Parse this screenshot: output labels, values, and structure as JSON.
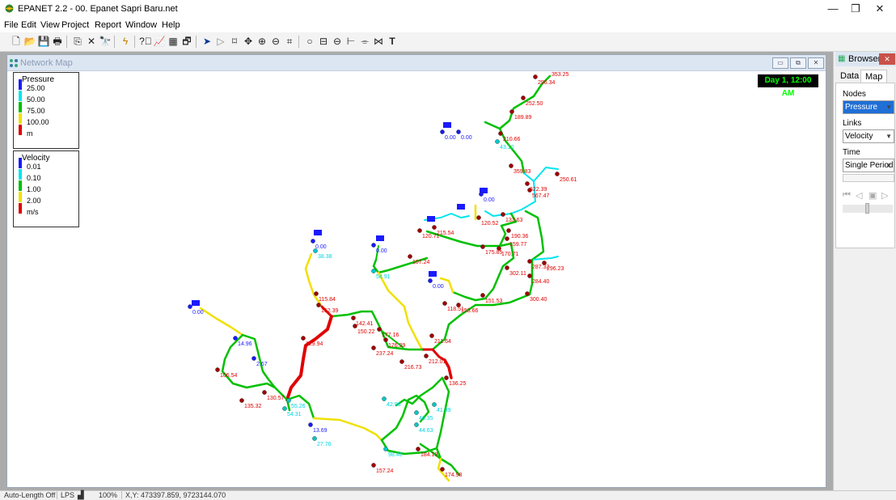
{
  "app": {
    "title": "EPANET 2.2 - 00. Epanet Sapri Baru.net"
  },
  "menu": [
    "File",
    "Edit",
    "View",
    "Project",
    "Report",
    "Window",
    "Help"
  ],
  "map_window": {
    "title": "Network Map",
    "time_display": "Day 1, 12:00 AM"
  },
  "legend_pressure": {
    "title": "Pressure",
    "entries": [
      {
        "label": "25.00",
        "color": "#1a1aff"
      },
      {
        "label": "50.00",
        "color": "#00e5ee"
      },
      {
        "label": "75.00",
        "color": "#00c000"
      },
      {
        "label": "100.00",
        "color": "#f0e000"
      }
    ],
    "top_color": "#e00000",
    "unit": "m"
  },
  "legend_velocity": {
    "title": "Velocity",
    "entries": [
      {
        "label": "0.01",
        "color": "#1a1aff"
      },
      {
        "label": "0.10",
        "color": "#00e5ee"
      },
      {
        "label": "1.00",
        "color": "#00c000"
      },
      {
        "label": "2.00",
        "color": "#f0e000"
      }
    ],
    "top_color": "#e00000",
    "unit": "m/s"
  },
  "browser": {
    "title": "Browser",
    "tabs": [
      "Data",
      "Map"
    ],
    "nodes_label": "Nodes",
    "nodes_value": "Pressure",
    "links_label": "Links",
    "links_value": "Velocity",
    "time_label": "Time",
    "time_value": "Single Period"
  },
  "status": {
    "auto_length": "Auto-Length Off",
    "flow_units": "LPS",
    "zoom": "100%",
    "xy": "X,Y: 473397.859, 9723144.070"
  },
  "node_labels": [
    {
      "t": "353.25",
      "c": "red"
    },
    {
      "t": "296.34",
      "c": "red"
    },
    {
      "t": "252.50",
      "c": "red"
    },
    {
      "t": "189.89",
      "c": "red"
    },
    {
      "t": "210.66",
      "c": "red"
    },
    {
      "t": "43.10",
      "c": "cyan"
    },
    {
      "t": "0.00",
      "c": "blue"
    },
    {
      "t": "0.00",
      "c": "blue"
    },
    {
      "t": "359.83",
      "c": "red"
    },
    {
      "t": "622.39",
      "c": "red"
    },
    {
      "t": "250.61",
      "c": "red"
    },
    {
      "t": "567.47",
      "c": "red"
    },
    {
      "t": "0.00",
      "c": "blue"
    },
    {
      "t": "120.52",
      "c": "red"
    },
    {
      "t": "133.63",
      "c": "red"
    },
    {
      "t": "215.54",
      "c": "red"
    },
    {
      "t": "120.71",
      "c": "red"
    },
    {
      "t": "190.36",
      "c": "red"
    },
    {
      "t": "159.77",
      "c": "red"
    },
    {
      "t": "175.85",
      "c": "red"
    },
    {
      "t": "170.71",
      "c": "red"
    },
    {
      "t": "287.32",
      "c": "red"
    },
    {
      "t": "296.23",
      "c": "red"
    },
    {
      "t": "302.11",
      "c": "red"
    },
    {
      "t": "284.40",
      "c": "red"
    },
    {
      "t": "300.40",
      "c": "red"
    },
    {
      "t": "107.24",
      "c": "red"
    },
    {
      "t": "0.00",
      "c": "blue"
    },
    {
      "t": "0.00",
      "c": "blue"
    },
    {
      "t": "0.00",
      "c": "blue"
    },
    {
      "t": "38.38",
      "c": "cyan"
    },
    {
      "t": "54.91",
      "c": "cyan"
    },
    {
      "t": "151.53",
      "c": "red"
    },
    {
      "t": "118.51",
      "c": "red"
    },
    {
      "t": "153.66",
      "c": "red"
    },
    {
      "t": "115.84",
      "c": "red"
    },
    {
      "t": "152.39",
      "c": "red"
    },
    {
      "t": "142.41",
      "c": "red"
    },
    {
      "t": "150.22",
      "c": "red"
    },
    {
      "t": "177.16",
      "c": "red"
    },
    {
      "t": "176.39",
      "c": "red"
    },
    {
      "t": "237.24",
      "c": "red"
    },
    {
      "t": "216.73",
      "c": "red"
    },
    {
      "t": "211.64",
      "c": "red"
    },
    {
      "t": "212.01",
      "c": "red"
    },
    {
      "t": "129.94",
      "c": "red"
    },
    {
      "t": "136.25",
      "c": "red"
    },
    {
      "t": "0.00",
      "c": "blue"
    },
    {
      "t": "14.96",
      "c": "blue"
    },
    {
      "t": "2.67",
      "c": "blue"
    },
    {
      "t": "106.54",
      "c": "red"
    },
    {
      "t": "130.57",
      "c": "red"
    },
    {
      "t": "135.32",
      "c": "red"
    },
    {
      "t": "55.26",
      "c": "cyan"
    },
    {
      "t": "54.31",
      "c": "cyan"
    },
    {
      "t": "13.69",
      "c": "blue"
    },
    {
      "t": "27.76",
      "c": "cyan"
    },
    {
      "t": "42.96",
      "c": "cyan"
    },
    {
      "t": "41.39",
      "c": "cyan"
    },
    {
      "t": "46.35",
      "c": "cyan"
    },
    {
      "t": "44.63",
      "c": "cyan"
    },
    {
      "t": "98.46",
      "c": "cyan"
    },
    {
      "t": "184.19",
      "c": "red"
    },
    {
      "t": "157.24",
      "c": "red"
    },
    {
      "t": "174.98",
      "c": "red"
    },
    {
      "t": "152.20",
      "c": "red"
    }
  ],
  "colors": {
    "red": "#e00000",
    "yellow": "#f0e000",
    "green": "#00c000",
    "cyan": "#00e5ee",
    "blue": "#1a1aff"
  }
}
